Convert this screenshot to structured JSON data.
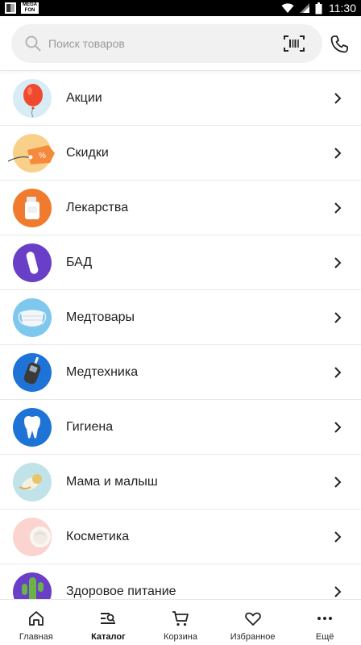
{
  "status_bar": {
    "time": "11:30",
    "app_badge": "MEGA FON"
  },
  "search": {
    "placeholder": "Поиск товаров"
  },
  "catalog": {
    "items": [
      {
        "label": "Акции"
      },
      {
        "label": "Скидки"
      },
      {
        "label": "Лекарства"
      },
      {
        "label": "БАД"
      },
      {
        "label": "Медтовары"
      },
      {
        "label": "Медтехника"
      },
      {
        "label": "Гигиена"
      },
      {
        "label": "Мама и малыш"
      },
      {
        "label": "Косметика"
      },
      {
        "label": "Здоровое питание"
      }
    ]
  },
  "bottom_nav": {
    "items": [
      {
        "label": "Главная"
      },
      {
        "label": "Каталог"
      },
      {
        "label": "Корзина"
      },
      {
        "label": "Избранное"
      },
      {
        "label": "Ещё"
      }
    ],
    "active_index": 1
  },
  "colors": {
    "accent": "#3c8dde",
    "sale_red": "#f04a2e",
    "discount_orange": "#f58a3c",
    "purple": "#6a3fc8",
    "blue": "#1e74d6"
  }
}
